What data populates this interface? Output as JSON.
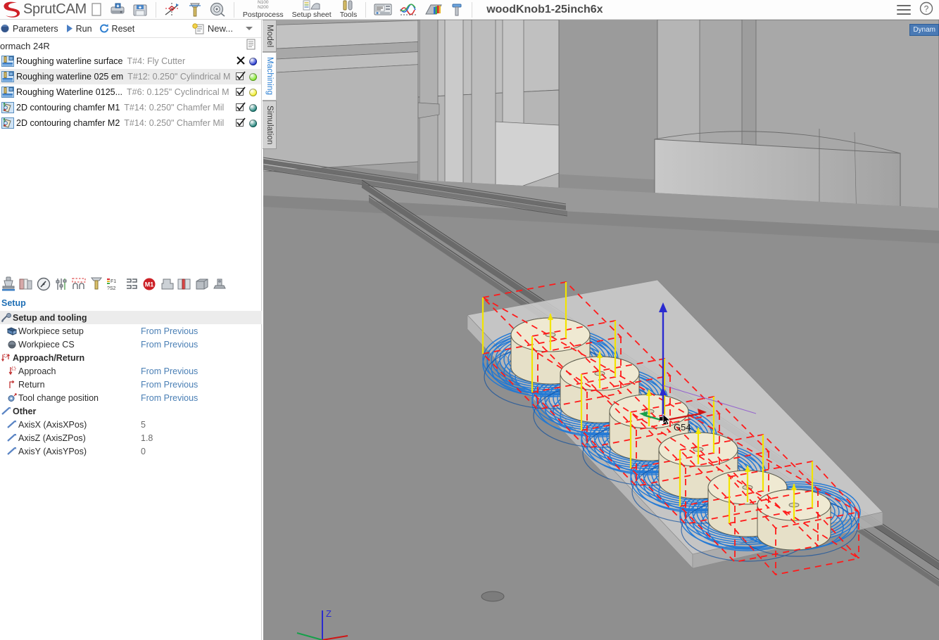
{
  "app": {
    "name": "SprutCAM",
    "document_title": "woodKnob1-25inch6x"
  },
  "topbar": {
    "buttons": [
      {
        "name": "new-document",
        "icon": "blank-page-icon",
        "label": ""
      },
      {
        "name": "open-document",
        "icon": "open-drive-icon",
        "label": ""
      },
      {
        "name": "save-document",
        "icon": "floppy-save-icon",
        "label": ""
      },
      {
        "name": "coordinate-system",
        "icon": "cs-origin-icon",
        "label": ""
      },
      {
        "name": "machining-setup",
        "icon": "tool-setup-icon",
        "label": ""
      },
      {
        "name": "measure",
        "icon": "measure-tape-icon",
        "label": ""
      }
    ],
    "labeled_buttons": [
      {
        "name": "postprocess",
        "label": "Postprocess",
        "icon": "nc-code-icon",
        "sub1": "N100",
        "sub2": "N200"
      },
      {
        "name": "setup-sheet",
        "label": "Setup sheet",
        "icon": "setup-sheet-icon"
      },
      {
        "name": "tools",
        "label": "Tools",
        "icon": "tools-icon"
      }
    ],
    "right_buttons": [
      {
        "name": "nc-editor",
        "icon": "nc-editor-icon"
      },
      {
        "name": "feed-analysis",
        "icon": "feed-curve-icon"
      },
      {
        "name": "color-map",
        "icon": "color-map-icon"
      },
      {
        "name": "tool-library",
        "icon": "tool-bolt-icon"
      }
    ],
    "menu_icon": "hamburger-menu-icon",
    "help_icon": "help-question-icon"
  },
  "commandbar": {
    "parameters": "Parameters",
    "run": "Run",
    "reset": "Reset",
    "new": "New...",
    "dropdown_icon": "chevron-down-icon"
  },
  "machine": {
    "name": "ormach 24R",
    "doc_icon": "document-icon"
  },
  "operations": [
    {
      "icon": "waterline-roughing-icon",
      "name": "Roughing waterline surface",
      "tool": "T#4: Fly Cutter",
      "check_icon": "disabled-x-icon",
      "status_color": "#1a2fd0",
      "selected": false
    },
    {
      "icon": "waterline-roughing-icon",
      "name": "Roughing waterline 025 em",
      "tool": "T#12: 0.250\" Cylindrical M",
      "check_icon": "checked-box-icon",
      "status_color": "#7ce820",
      "selected": true
    },
    {
      "icon": "waterline-roughing-icon",
      "name": "Roughing Waterline 0125...",
      "tool": "T#6: 0.125\" Cyclindrical M",
      "check_icon": "checked-box-icon",
      "status_color": "#f2ef22",
      "selected": false
    },
    {
      "icon": "contouring-chamfer-icon",
      "name": "2D contouring chamfer M1",
      "tool": "T#14: 0.250\" Chamfer Mil",
      "check_icon": "checked-box-icon",
      "status_color": "#147d74",
      "selected": false
    },
    {
      "icon": "contouring-chamfer-icon",
      "name": "2D contouring chamfer M2",
      "tool": "T#14: 0.250\" Chamfer Mil",
      "check_icon": "checked-box-icon",
      "status_color": "#147d74",
      "selected": false
    }
  ],
  "op_toolbar": [
    {
      "name": "tool-setup-button",
      "icon": "tool-head-icon"
    },
    {
      "name": "stock-button",
      "icon": "stock-cylinder-icon"
    },
    {
      "name": "speed-button",
      "icon": "gauge-icon"
    },
    {
      "name": "levels-button",
      "icon": "levels-slider-icon"
    },
    {
      "name": "contour-button",
      "icon": "contour-wave-icon"
    },
    {
      "name": "tool-button",
      "icon": "endmill-icon"
    },
    {
      "name": "feeds-speeds-button",
      "icon": "feeds-f1s2-icon"
    },
    {
      "name": "links-button",
      "icon": "links-icon"
    },
    {
      "name": "m1-stop-button",
      "icon": "m1-stop-icon"
    },
    {
      "name": "part-button",
      "icon": "part-stepped-icon"
    },
    {
      "name": "workpiece-button",
      "icon": "workpiece-red-icon"
    },
    {
      "name": "solid-button",
      "icon": "solid-block-icon"
    },
    {
      "name": "machine-button",
      "icon": "machine-icon"
    }
  ],
  "setup": {
    "header": "Setup",
    "rows": [
      {
        "icon": "wrench-icon",
        "label": "Setup and tooling",
        "value": "",
        "group": true,
        "indent": 0,
        "bold": true
      },
      {
        "icon": "workpiece-setup-icon",
        "label": "Workpiece setup",
        "value": "From Previous",
        "group": false,
        "indent": 1,
        "bold": false
      },
      {
        "icon": "workpiece-cs-icon",
        "label": "Workpiece CS",
        "value": "From Previous",
        "group": false,
        "indent": 1,
        "bold": false
      },
      {
        "icon": "approach-return-icon",
        "label": "Approach/Return",
        "value": "",
        "group": false,
        "indent": 0,
        "bold": true
      },
      {
        "icon": "approach-icon",
        "label": "Approach",
        "value": "From Previous",
        "group": false,
        "indent": 1,
        "bold": false
      },
      {
        "icon": "return-icon",
        "label": "Return",
        "value": "From Previous",
        "group": false,
        "indent": 1,
        "bold": false
      },
      {
        "icon": "tool-change-icon",
        "label": "Tool change position",
        "value": "From Previous",
        "group": false,
        "indent": 1,
        "bold": false
      },
      {
        "icon": "other-icon",
        "label": "Other",
        "value": "",
        "group": false,
        "indent": 0,
        "bold": true
      },
      {
        "icon": "axis-icon",
        "label": "AxisX (AxisXPos)",
        "value": "5",
        "group": false,
        "indent": 1,
        "bold": false,
        "numeric": true
      },
      {
        "icon": "axis-icon",
        "label": "AxisZ (AxisZPos)",
        "value": "1.8",
        "group": false,
        "indent": 1,
        "bold": false,
        "numeric": true
      },
      {
        "icon": "axis-icon",
        "label": "AxisY (AxisYPos)",
        "value": "0",
        "group": false,
        "indent": 1,
        "bold": false,
        "numeric": true
      }
    ]
  },
  "vtabs": [
    {
      "label": "Model",
      "active": false
    },
    {
      "label": "Machining",
      "active": true
    },
    {
      "label": "Simulation",
      "active": false
    }
  ],
  "viewport": {
    "dynamic_label": "Dynam",
    "g54_label": "G54",
    "axis_z_label": "Z",
    "background_color": "#8f8f8f",
    "toolpath_colors": {
      "cut_move": "#1f78d6",
      "rapid_move": "#ff1a1a",
      "plunge_move": "#f2e400",
      "tool_body": "#c79a3a"
    },
    "scene": "CNC router machine simulation with 6 turned wood knob parts on table, waterline roughing toolpath displayed"
  }
}
